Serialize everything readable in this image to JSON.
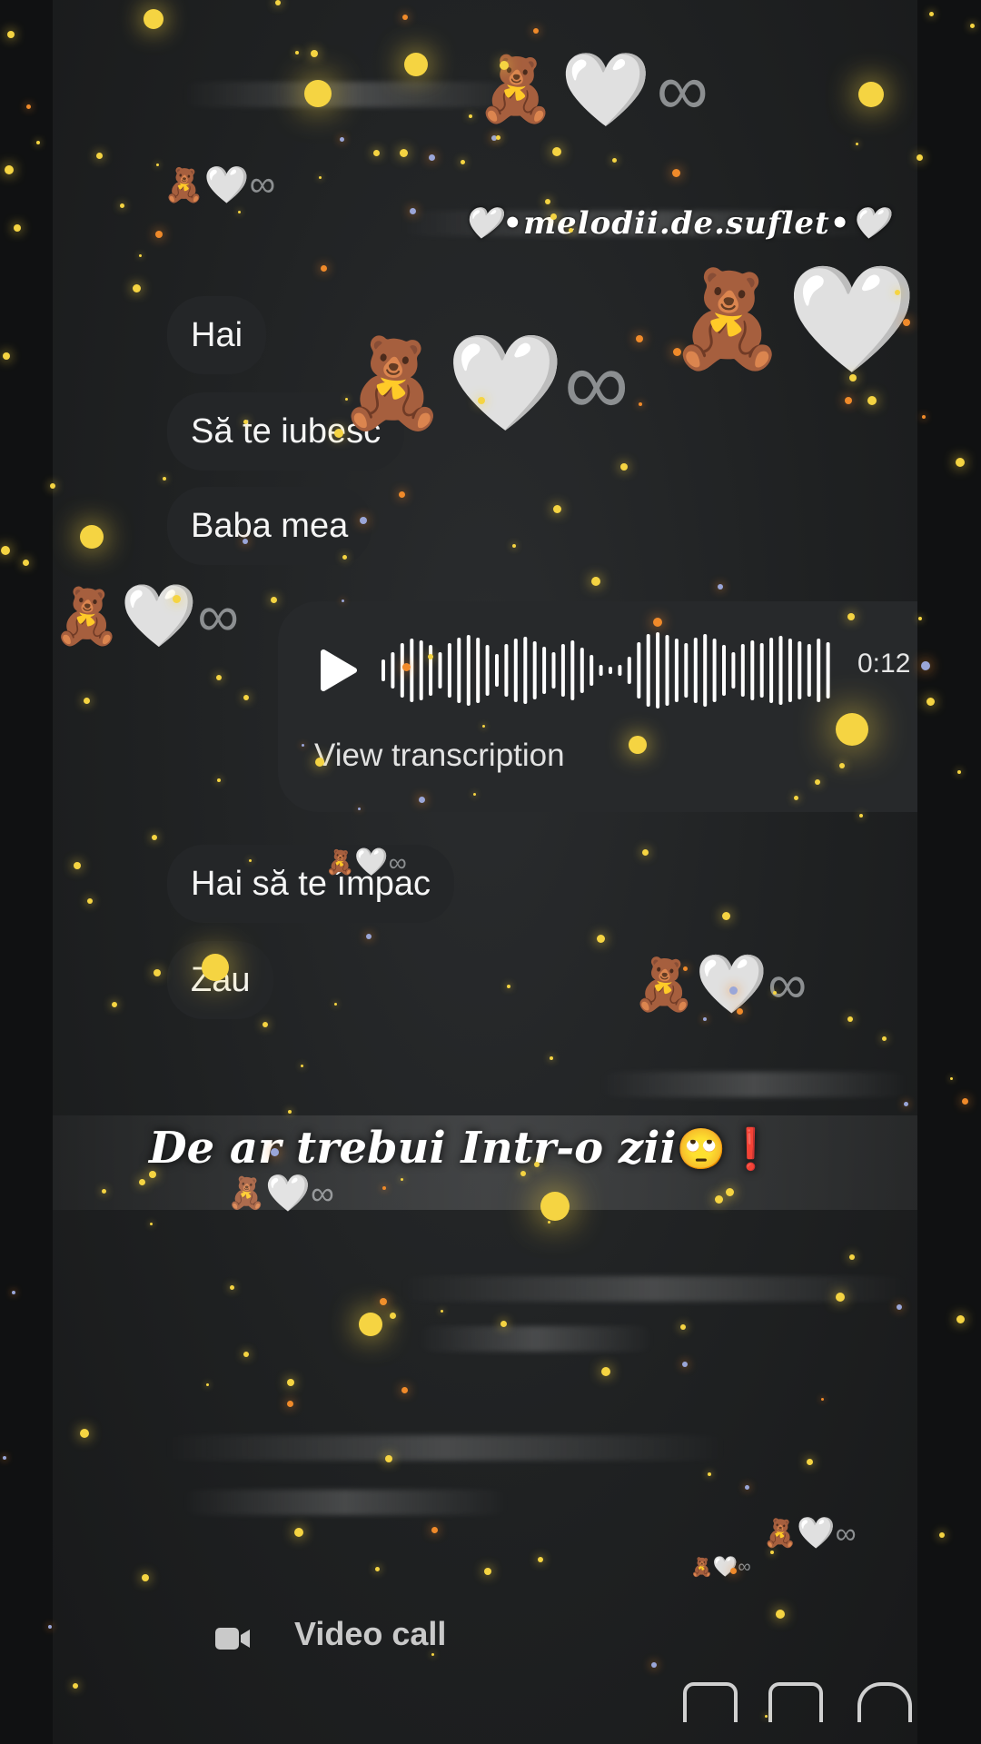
{
  "overlay": {
    "watermark": "•melodii.de.suflet•",
    "lyric": "De ar trebui Intr-o zii",
    "lyric_emoji": "🙄",
    "lyric_mark": "❗"
  },
  "chat": {
    "messages": [
      {
        "text": "Hai"
      },
      {
        "text": "Să te iubesc"
      },
      {
        "text": "Baba mea"
      },
      {
        "text": "Hai să te împac"
      },
      {
        "text": "Zău"
      }
    ],
    "voice_message": {
      "duration": "0:12",
      "transcription_label": "View transcription"
    }
  },
  "bottom_bar": {
    "video_call_label": "Video call"
  },
  "decorations": {
    "bear": "🧸",
    "heart": "🤍",
    "infinity": "∞"
  },
  "colors": {
    "background": "#1f2122",
    "bubble": "#242628",
    "voice_bubble": "#27292b",
    "sparkle_gold": "#f5d442"
  }
}
